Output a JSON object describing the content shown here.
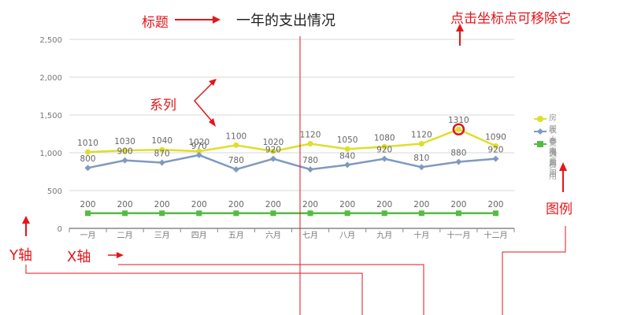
{
  "chart_data": {
    "type": "line",
    "title": "一年的支出情况",
    "categories": [
      "一月",
      "二月",
      "三月",
      "四月",
      "五月",
      "六月",
      "七月",
      "八月",
      "九月",
      "十月",
      "十一月",
      "十二月"
    ],
    "ylim": [
      0,
      2500
    ],
    "yticks": [
      "0",
      "500",
      "1,000",
      "1,500",
      "2,000",
      "2,500"
    ],
    "grid": true,
    "legend_position": "right",
    "series": [
      {
        "name": "房屋水电费用",
        "color": "#dede2e",
        "marker": "circle",
        "values": [
          1010,
          1030,
          1040,
          1020,
          1100,
          1020,
          1120,
          1050,
          1080,
          1120,
          1310,
          1090
        ]
      },
      {
        "name": "衣食费用",
        "color": "#7f9abf",
        "marker": "diamond",
        "values": [
          800,
          900,
          870,
          970,
          780,
          920,
          780,
          840,
          920,
          810,
          880,
          920
        ]
      },
      {
        "name": "交通费用",
        "color": "#55bb44",
        "marker": "square",
        "values": [
          200,
          200,
          200,
          200,
          200,
          200,
          200,
          200,
          200,
          200,
          200,
          200
        ]
      }
    ]
  },
  "annotations": {
    "title_label": "标题",
    "remove_hint": "点击坐标点可移除它",
    "series_label": "系列",
    "legend_label": "图例",
    "y_axis_label": "Y轴",
    "x_axis_label": "X轴"
  },
  "colors": {
    "annotation": "#e3161b",
    "grid": "#d9d9d9",
    "axis": "#888888"
  }
}
